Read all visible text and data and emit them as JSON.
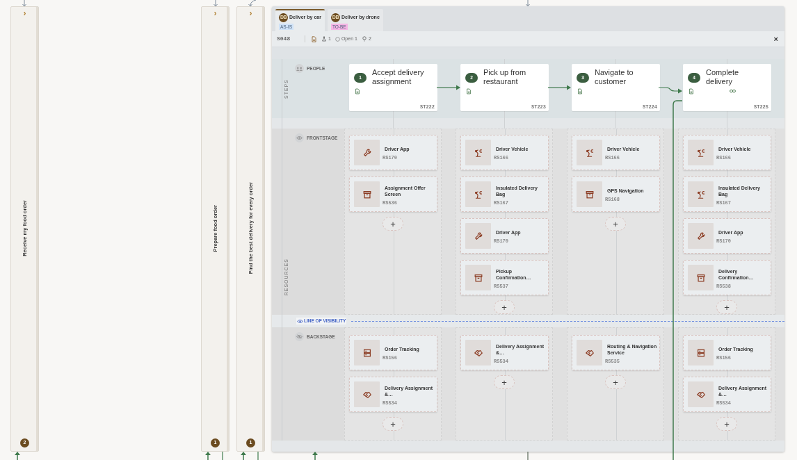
{
  "journey_columns": [
    {
      "title": "Receive my food order",
      "chevron": "›",
      "count": "2"
    },
    {
      "title": "Prepare food order",
      "chevron": "›",
      "count": "1"
    },
    {
      "title": "Find the best delivery for every order",
      "chevron": "›",
      "count": "1"
    }
  ],
  "tabs": [
    {
      "avatar": "DB",
      "label": "Deliver by car",
      "tag": "AS-IS",
      "color": "#cfe2f7",
      "selected": true
    },
    {
      "avatar": "DB",
      "label": "Deliver by drone",
      "tag": "TO-BE",
      "color": "#f5b5e4",
      "selected": false
    }
  ],
  "toolbar": {
    "id": "S048",
    "personas": "1",
    "open": "Open 1",
    "ideas": "2",
    "close": "×"
  },
  "side_labels": {
    "steps": "STEPS",
    "resources": "RESOURCES"
  },
  "lanes": {
    "people": "PEOPLE",
    "frontstage": "FRONTSTAGE",
    "line_of_visibility": "LINE OF VISIBILITY",
    "backstage": "BACKSTAGE"
  },
  "steps": [
    {
      "number": "1",
      "title": "Accept delivery assignment",
      "code": "ST222",
      "linked": false
    },
    {
      "number": "2",
      "title": "Pick up from restaurant",
      "code": "ST223",
      "linked": false
    },
    {
      "number": "3",
      "title": "Navigate to customer",
      "code": "ST224",
      "linked": false
    },
    {
      "number": "4",
      "title": "Complete delivery",
      "code": "ST225",
      "linked": true
    }
  ],
  "frontstage": [
    {
      "add": "+",
      "resources": [
        {
          "kind": "tool",
          "name": "Driver App",
          "code": "RS170"
        },
        {
          "kind": "screen",
          "name": "Assignment Offer Screen",
          "code": "RS536"
        }
      ]
    },
    {
      "add": "+",
      "resources": [
        {
          "kind": "equipment",
          "name": "Driver Vehicle",
          "code": "RS166"
        },
        {
          "kind": "equipment",
          "name": "Insulated Delivery Bag",
          "code": "RS167"
        },
        {
          "kind": "tool",
          "name": "Driver App",
          "code": "RS170"
        },
        {
          "kind": "screen",
          "name": "Pickup Confirmation…",
          "code": "RS537"
        }
      ]
    },
    {
      "add": "+",
      "resources": [
        {
          "kind": "equipment",
          "name": "Driver Vehicle",
          "code": "RS166"
        },
        {
          "kind": "screen",
          "name": "GPS Navigation",
          "code": "RS168"
        }
      ]
    },
    {
      "add": "+",
      "resources": [
        {
          "kind": "equipment",
          "name": "Driver Vehicle",
          "code": "RS166"
        },
        {
          "kind": "equipment",
          "name": "Insulated Delivery Bag",
          "code": "RS167"
        },
        {
          "kind": "tool",
          "name": "Driver App",
          "code": "RS170"
        },
        {
          "kind": "screen",
          "name": "Delivery Confirmation…",
          "code": "RS538"
        }
      ]
    }
  ],
  "backstage": [
    {
      "add": "+",
      "resources": [
        {
          "kind": "system",
          "name": "Order Tracking",
          "code": "RS156"
        },
        {
          "kind": "service",
          "name": "Delivery Assignment &…",
          "code": "RS534"
        }
      ]
    },
    {
      "add": "+",
      "resources": [
        {
          "kind": "service",
          "name": "Delivery Assignment &…",
          "code": "RS534"
        }
      ]
    },
    {
      "add": "+",
      "resources": [
        {
          "kind": "service",
          "name": "Routing & Navigation Service",
          "code": "RS535"
        }
      ]
    },
    {
      "add": "+",
      "resources": [
        {
          "kind": "system",
          "name": "Order Tracking",
          "code": "RS156"
        },
        {
          "kind": "service",
          "name": "Delivery Assignment &…",
          "code": "RS534"
        }
      ]
    }
  ]
}
